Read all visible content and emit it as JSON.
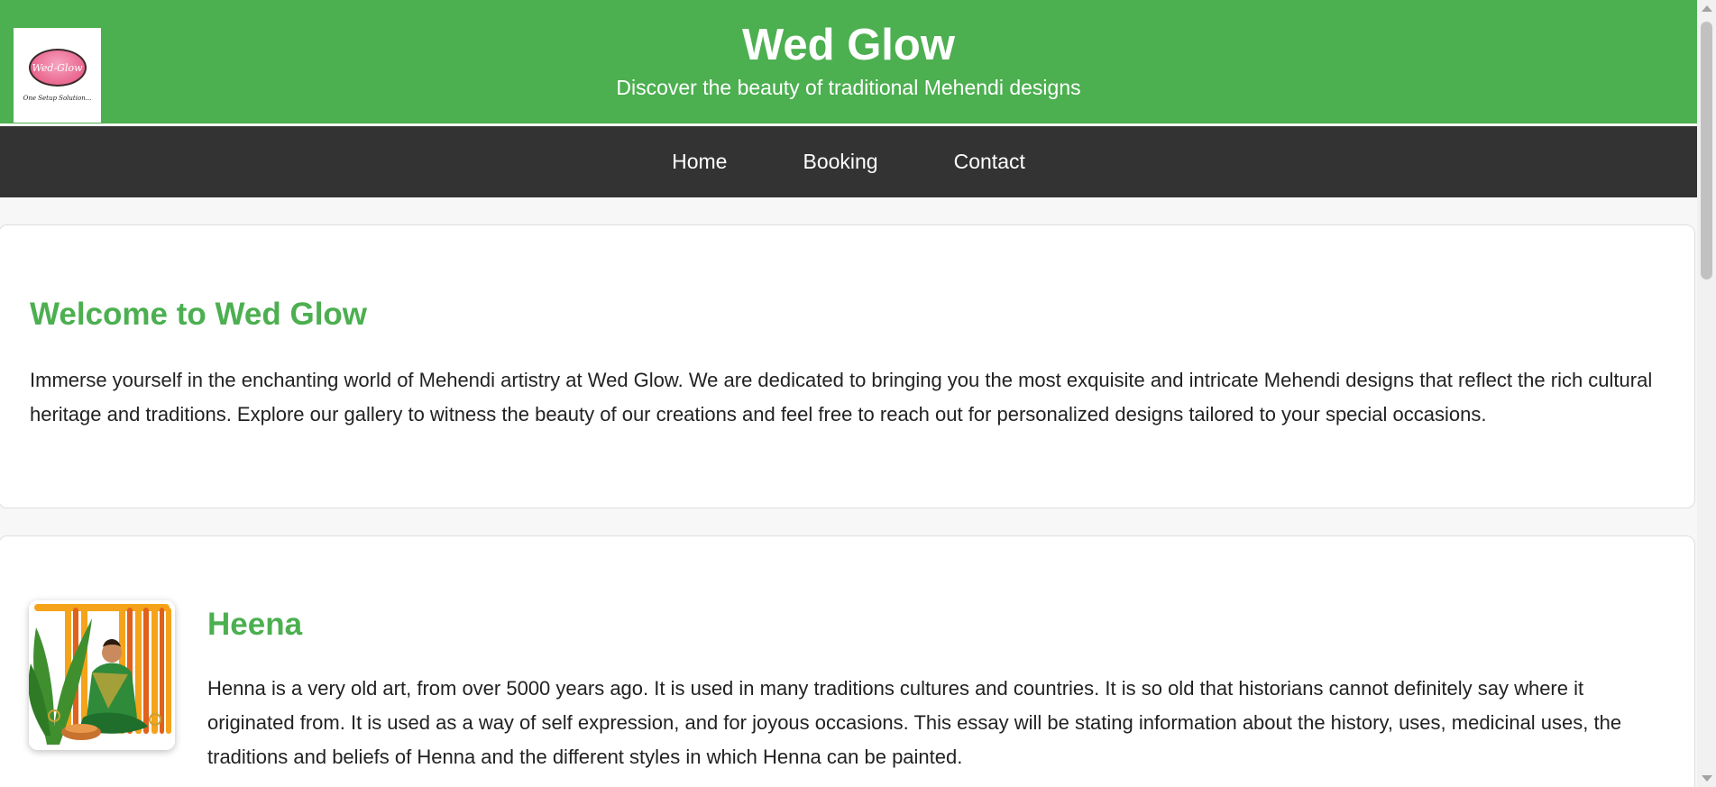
{
  "header": {
    "title": "Wed Glow",
    "subtitle": "Discover the beauty of traditional Mehendi designs",
    "logo": {
      "text": "Wed-Glow",
      "tagline": "One Setup Solution..."
    }
  },
  "nav": {
    "items": [
      {
        "label": "Home"
      },
      {
        "label": "Booking"
      },
      {
        "label": "Contact"
      }
    ]
  },
  "welcome": {
    "title": "Welcome to Wed Glow",
    "body": "Immerse yourself in the enchanting world of Mehendi artistry at Wed Glow. We are dedicated to bringing you the most exquisite and intricate Mehendi designs that reflect the rich cultural heritage and traditions. Explore our gallery to witness the beauty of our creations and feel free to reach out for personalized designs tailored to your special occasions."
  },
  "henna": {
    "title": "Heena",
    "body": "Henna is a very old art, from over 5000 years ago. It is used in many traditions cultures and countries. It is so old that historians cannot definitely say where it originated from. It is used as a way of self expression, and for joyous occasions. This essay will be stating information about the history, uses, medicinal uses, the traditions and beliefs of Henna and the different styles in which Henna can be painted."
  },
  "colors": {
    "brand_green": "#4caf50",
    "nav_dark": "#333333",
    "page_bg": "#f7f7f7"
  },
  "icons": {
    "logo": "wed-glow-logo",
    "henna_illustration": "henna-bride-illustration"
  }
}
